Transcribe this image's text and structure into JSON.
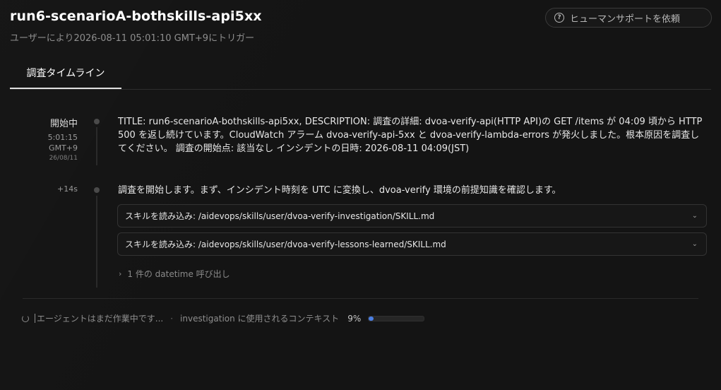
{
  "header": {
    "title": "run6-scenarioA-bothskills-api5xx",
    "subtitle": "ユーザーにより2026-08-11 05:01:10 GMT+9にトリガー",
    "help_button": {
      "label": "ヒューマンサポートを依頼",
      "icon": "question-circle-icon"
    }
  },
  "tabs": [
    {
      "label": "調査タイムライン",
      "active": true
    }
  ],
  "timeline": [
    {
      "status": "開始中",
      "time": "5:01:15",
      "tz": "GMT+9",
      "date": "26/08/11",
      "text": "TITLE: run6-scenarioA-bothskills-api5xx, DESCRIPTION: 調査の詳細: dvoa-verify-api(HTTP API)の GET /items が 04:09 頃から HTTP 500 を返し続けています。CloudWatch アラーム dvoa-verify-api-5xx と dvoa-verify-lambda-errors が発火しました。根本原因を調査してください。 調査の開始点: 該当なし インシデントの日時: 2026-08-11 04:09(JST)"
    },
    {
      "offset": "+14s",
      "text": "調査を開始します。まず、インシデント時刻を UTC に変換し、dvoa-verify 環境の前提知識を確認します。",
      "skills": [
        {
          "label": "スキルを読み込み: /aidevops/skills/user/dvoa-verify-investigation/SKILL.md"
        },
        {
          "label": "スキルを読み込み: /aidevops/skills/user/dvoa-verify-lessons-learned/SKILL.md"
        }
      ],
      "calls_label": "1 件の datetime 呼び出し"
    }
  ],
  "status_bar": {
    "agent_status": "エージェントはまだ作業中です...",
    "separator": "·",
    "context_label": "investigation に使用されるコンテキスト",
    "context_percent_text": "9%",
    "context_fraction": 0.09,
    "accent_color": "#4b7fe3"
  }
}
